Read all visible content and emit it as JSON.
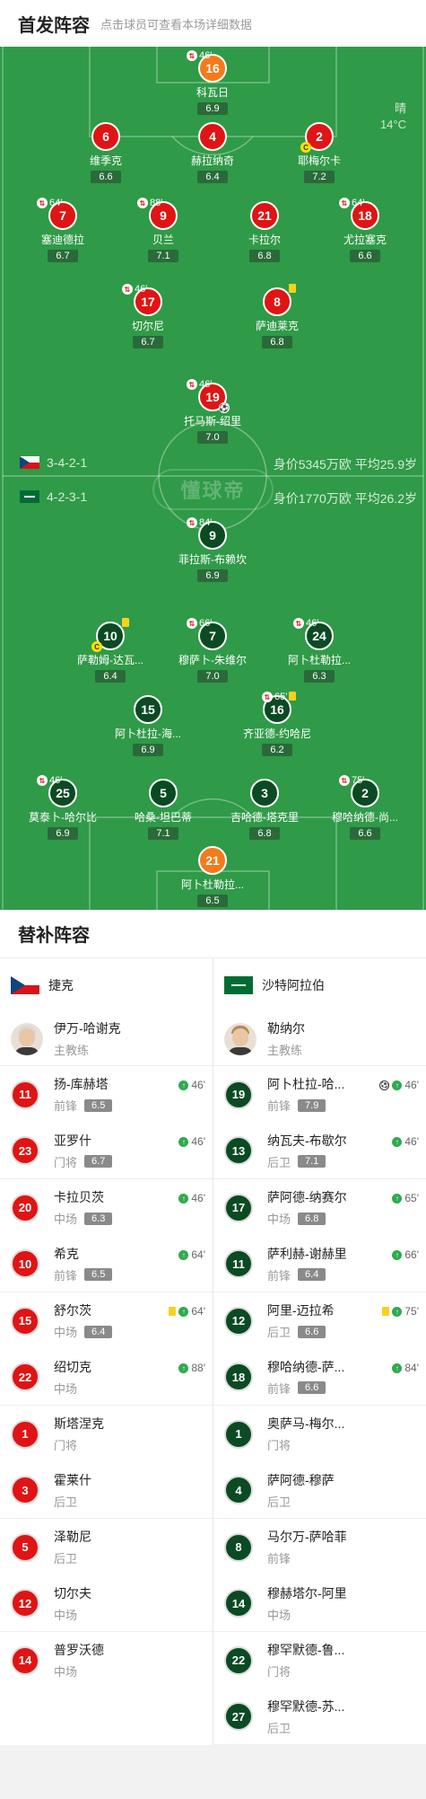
{
  "header": {
    "title": "首发阵容",
    "subtitle": "点击球员可查看本场详细数据"
  },
  "weather": {
    "condition": "晴",
    "temp": "14°C"
  },
  "watermark": "懂球帝",
  "home": {
    "formation": "3-4-2-1",
    "value": "身价5345万欧 平均25.9岁"
  },
  "away": {
    "formation": "4-2-3-1",
    "value": "身价1770万欧 平均26.2岁"
  },
  "home_players": [
    {
      "num": "16",
      "name": "科瓦日",
      "rating": "6.9",
      "kit": "o",
      "sub_time": "46'"
    },
    {
      "num": "6",
      "name": "维季克",
      "rating": "6.6",
      "kit": "r"
    },
    {
      "num": "4",
      "name": "赫拉纳奇",
      "rating": "6.4",
      "kit": "r"
    },
    {
      "num": "2",
      "name": "耶梅尔卡",
      "rating": "7.2",
      "kit": "r",
      "captain": "C"
    },
    {
      "num": "7",
      "name": "塞迪德拉",
      "rating": "6.7",
      "kit": "r",
      "sub_time": "64'"
    },
    {
      "num": "9",
      "name": "贝兰",
      "rating": "7.1",
      "kit": "r",
      "sub_time": "88'"
    },
    {
      "num": "21",
      "name": "卡拉尔",
      "rating": "6.8",
      "kit": "r"
    },
    {
      "num": "18",
      "name": "尤拉塞克",
      "rating": "6.6",
      "kit": "r",
      "sub_time": "64'"
    },
    {
      "num": "17",
      "name": "切尔尼",
      "rating": "6.7",
      "kit": "r",
      "sub_time": "46'"
    },
    {
      "num": "8",
      "name": "萨迪莱克",
      "rating": "6.8",
      "kit": "r",
      "yellow": true
    },
    {
      "num": "19",
      "name": "托马斯-绍里",
      "rating": "7.0",
      "kit": "r",
      "sub_time": "46'",
      "goal": true
    }
  ],
  "away_players": [
    {
      "num": "9",
      "name": "菲拉斯-布赖坎",
      "rating": "6.9",
      "kit": "g",
      "sub_time": "84'"
    },
    {
      "num": "10",
      "name": "萨勒姆-达瓦...",
      "rating": "6.4",
      "kit": "g",
      "yellow": true,
      "captain": "C"
    },
    {
      "num": "7",
      "name": "穆萨卜-朱维尔",
      "rating": "7.0",
      "kit": "g",
      "sub_time": "66'"
    },
    {
      "num": "24",
      "name": "阿卜杜勒拉...",
      "rating": "6.3",
      "kit": "g",
      "sub_time": "46'"
    },
    {
      "num": "15",
      "name": "阿卜杜拉-海...",
      "rating": "6.9",
      "kit": "g"
    },
    {
      "num": "16",
      "name": "齐亚德-约哈尼",
      "rating": "6.2",
      "kit": "g",
      "sub_time": "65'",
      "yellow": true
    },
    {
      "num": "25",
      "name": "莫泰卜-哈尔比",
      "rating": "6.9",
      "kit": "g",
      "sub_time": "46'"
    },
    {
      "num": "5",
      "name": "哈桑-坦巴蒂",
      "rating": "7.1",
      "kit": "g"
    },
    {
      "num": "3",
      "name": "吉哈德-塔克里",
      "rating": "6.8",
      "kit": "g"
    },
    {
      "num": "2",
      "name": "穆哈纳德-尚...",
      "rating": "6.6",
      "kit": "g",
      "sub_time": "75'"
    },
    {
      "num": "21",
      "name": "阿卜杜勒拉...",
      "rating": "6.5",
      "kit": "o"
    }
  ],
  "subs": {
    "title": "替补阵容",
    "home": {
      "team": "捷克",
      "coach": {
        "name": "伊万-哈谢克",
        "role": "主教练"
      },
      "players": [
        {
          "num": "11",
          "name": "扬-库赫塔",
          "pos": "前锋",
          "rating": "6.5",
          "in": "46'"
        },
        {
          "num": "23",
          "name": "亚罗什",
          "pos": "门将",
          "rating": "6.7",
          "in": "46'"
        },
        {
          "num": "20",
          "name": "卡拉贝茨",
          "pos": "中场",
          "rating": "6.3",
          "in": "46'"
        },
        {
          "num": "10",
          "name": "希克",
          "pos": "前锋",
          "rating": "6.5",
          "in": "64'"
        },
        {
          "num": "15",
          "name": "舒尔茨",
          "pos": "中场",
          "rating": "6.4",
          "in": "64'",
          "yellow": true
        },
        {
          "num": "22",
          "name": "绍切克",
          "pos": "中场",
          "rating": "",
          "in": "88'"
        },
        {
          "num": "1",
          "name": "斯塔涅克",
          "pos": "门将",
          "rating": "",
          "in": ""
        },
        {
          "num": "3",
          "name": "霍莱什",
          "pos": "后卫",
          "rating": "",
          "in": ""
        },
        {
          "num": "5",
          "name": "泽勒尼",
          "pos": "后卫",
          "rating": "",
          "in": ""
        },
        {
          "num": "12",
          "name": "切尔夫",
          "pos": "中场",
          "rating": "",
          "in": ""
        },
        {
          "num": "14",
          "name": "普罗沃德",
          "pos": "中场",
          "rating": "",
          "in": ""
        }
      ]
    },
    "away": {
      "team": "沙特阿拉伯",
      "coach": {
        "name": "勒纳尔",
        "role": "主教练"
      },
      "players": [
        {
          "num": "19",
          "name": "阿卜杜拉-哈...",
          "pos": "前锋",
          "rating": "7.9",
          "in": "46'",
          "goal": true
        },
        {
          "num": "13",
          "name": "纳瓦夫-布歇尔",
          "pos": "后卫",
          "rating": "7.1",
          "in": "46'"
        },
        {
          "num": "17",
          "name": "萨阿德-纳赛尔",
          "pos": "中场",
          "rating": "6.8",
          "in": "65'"
        },
        {
          "num": "11",
          "name": "萨利赫-谢赫里",
          "pos": "前锋",
          "rating": "6.4",
          "in": "66'"
        },
        {
          "num": "12",
          "name": "阿里-迈拉希",
          "pos": "后卫",
          "rating": "6.6",
          "in": "75'",
          "yellow": true
        },
        {
          "num": "18",
          "name": "穆哈纳德-萨...",
          "pos": "前锋",
          "rating": "6.6",
          "in": "84'"
        },
        {
          "num": "1",
          "name": "奥萨马-梅尔...",
          "pos": "门将",
          "rating": "",
          "in": ""
        },
        {
          "num": "4",
          "name": "萨阿德-穆萨",
          "pos": "后卫",
          "rating": "",
          "in": ""
        },
        {
          "num": "8",
          "name": "马尔万-萨哈菲",
          "pos": "前锋",
          "rating": "",
          "in": ""
        },
        {
          "num": "14",
          "name": "穆赫塔尔-阿里",
          "pos": "中场",
          "rating": "",
          "in": ""
        },
        {
          "num": "22",
          "name": "穆罕默德-鲁...",
          "pos": "门将",
          "rating": "",
          "in": ""
        },
        {
          "num": "27",
          "name": "穆罕默德-苏...",
          "pos": "后卫",
          "rating": "",
          "in": ""
        }
      ]
    }
  }
}
